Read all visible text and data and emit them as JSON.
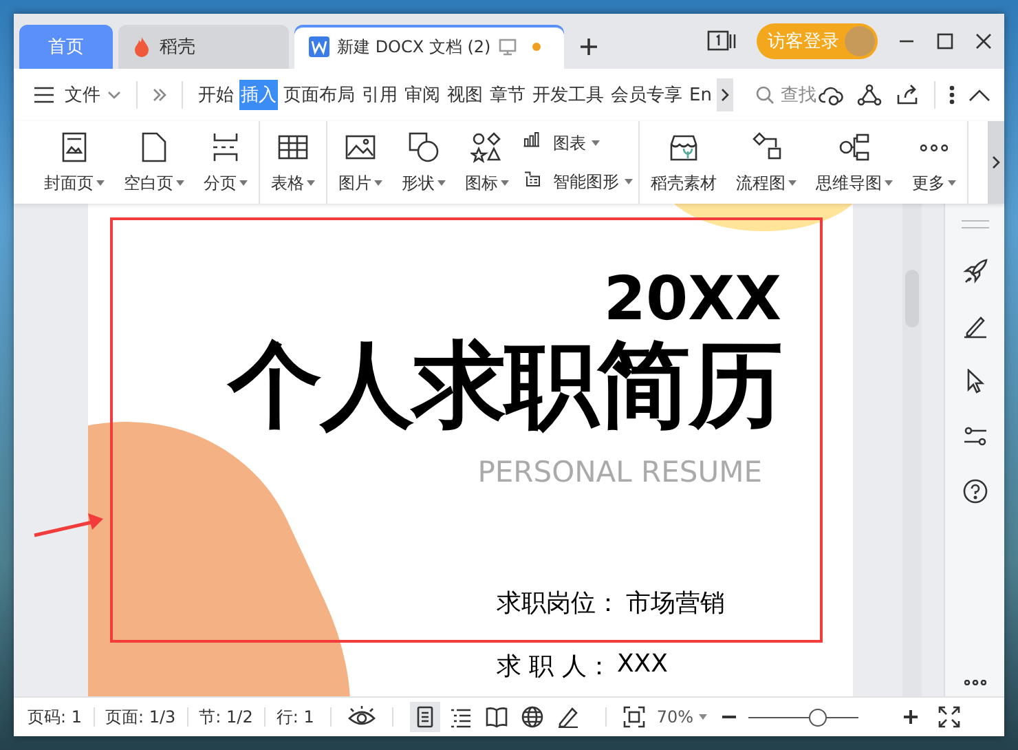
{
  "tabs": [
    {
      "label": "首页",
      "kind": "home",
      "selected": false
    },
    {
      "label": "稻壳",
      "kind": "docer",
      "selected": false
    },
    {
      "label": "新建 DOCX 文档 (2)",
      "kind": "document",
      "selected": true,
      "modified": true
    }
  ],
  "account": {
    "label": "访客登录"
  },
  "menu": {
    "file_label": "文件",
    "tabs": [
      {
        "label": "开始",
        "selected": false
      },
      {
        "label": "插入",
        "selected": true
      },
      {
        "label": "页面布局",
        "selected": false
      },
      {
        "label": "引用",
        "selected": false
      },
      {
        "label": "审阅",
        "selected": false
      },
      {
        "label": "视图",
        "selected": false
      },
      {
        "label": "章节",
        "selected": false
      },
      {
        "label": "开发工具",
        "selected": false
      },
      {
        "label": "会员专享",
        "selected": false
      },
      {
        "label": "En",
        "selected": false
      }
    ],
    "search": {
      "placeholder": "查找"
    }
  },
  "ribbon": {
    "groups": [
      {
        "items": [
          {
            "label": "封面页",
            "kind": "big",
            "dropdown": true
          },
          {
            "label": "空白页",
            "kind": "big",
            "dropdown": true
          },
          {
            "label": "分页",
            "kind": "big",
            "dropdown": true
          }
        ]
      },
      {
        "items": [
          {
            "label": "表格",
            "kind": "big",
            "dropdown": true
          }
        ]
      },
      {
        "items": [
          {
            "label": "图片",
            "kind": "big",
            "dropdown": true
          },
          {
            "label": "形状",
            "kind": "big",
            "dropdown": true
          },
          {
            "label": "图标",
            "kind": "big",
            "dropdown": true
          },
          {
            "label": "图表",
            "kind": "small",
            "dropdown": true
          },
          {
            "label": "智能图形",
            "kind": "small",
            "dropdown": true
          }
        ]
      },
      {
        "items": [
          {
            "label": "稻壳素材",
            "kind": "big",
            "dropdown": false
          },
          {
            "label": "流程图",
            "kind": "big",
            "dropdown": true
          },
          {
            "label": "思维导图",
            "kind": "big",
            "dropdown": true
          },
          {
            "label": "更多",
            "kind": "big",
            "dropdown": true
          }
        ]
      }
    ]
  },
  "document": {
    "year": "20XX",
    "title": "个人求职简历",
    "subtitle": "PERSONAL RESUME",
    "fields": [
      {
        "label": "求职岗位：",
        "value": "市场营销"
      },
      {
        "label": "求 职 人：",
        "value": "XXX"
      }
    ]
  },
  "status_bar": {
    "items": [
      "页码: 1",
      "页面: 1/3",
      "节: 1/2",
      "行: 1"
    ],
    "views": [
      {
        "kind": "page",
        "selected": true
      },
      {
        "kind": "outline",
        "selected": false
      },
      {
        "kind": "read",
        "selected": false
      },
      {
        "kind": "web",
        "selected": false
      },
      {
        "kind": "write",
        "selected": false
      }
    ],
    "zoom": "70%",
    "zoom_slider": {
      "level": 0.63
    }
  }
}
